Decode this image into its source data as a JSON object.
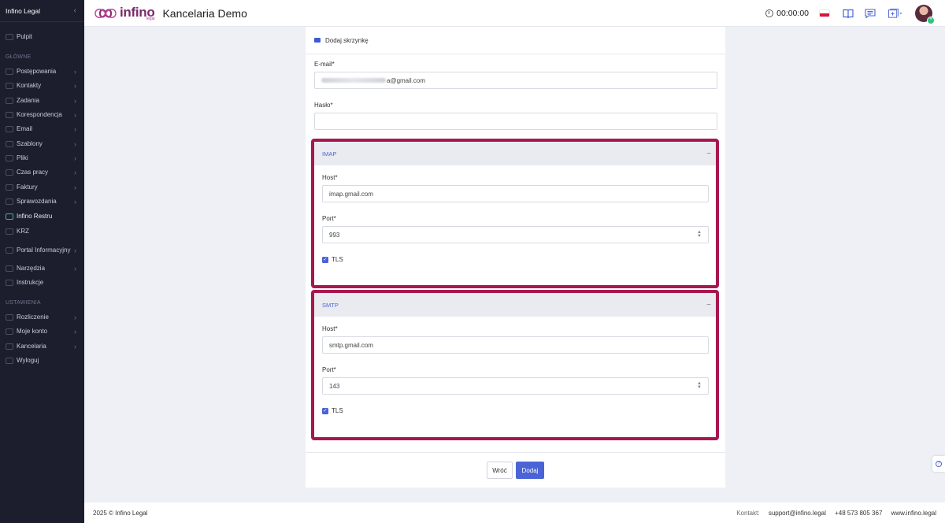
{
  "sidebar": {
    "title": "Infino Legal",
    "collapse_icon": "chevron-left-icon",
    "section_main": "GŁÓWNE",
    "section_settings": "USTAWIENIA",
    "top_item": {
      "label": "Pulpit",
      "icon": "dashboard-icon"
    },
    "main_items": [
      {
        "label": "Postępowania",
        "icon": "gavel-icon",
        "chevron": "›"
      },
      {
        "label": "Kontakty",
        "icon": "contacts-icon",
        "chevron": "›"
      },
      {
        "label": "Zadania",
        "icon": "tasks-icon",
        "chevron": "›"
      },
      {
        "label": "Korespondencja",
        "icon": "mail-icon",
        "chevron": "›"
      },
      {
        "label": "Email",
        "icon": "email-icon",
        "chevron": "›"
      },
      {
        "label": "Szablony",
        "icon": "templates-icon",
        "chevron": "›"
      },
      {
        "label": "Pliki",
        "icon": "files-icon",
        "chevron": "›"
      },
      {
        "label": "Czas pracy",
        "icon": "clock-icon",
        "chevron": "›"
      },
      {
        "label": "Faktury",
        "icon": "invoice-icon",
        "chevron": "›"
      },
      {
        "label": "Sprawozdania",
        "icon": "reports-icon",
        "chevron": "›"
      },
      {
        "label": "Infino Restru",
        "icon": "infinity-icon",
        "chevron": ""
      },
      {
        "label": "KRZ",
        "icon": "registry-icon",
        "chevron": ""
      },
      {
        "label": "Portal Informacyjny",
        "icon": "portal-icon",
        "chevron": "›"
      },
      {
        "label": "Narzędzia",
        "icon": "tools-icon",
        "chevron": "›"
      },
      {
        "label": "Instrukcje",
        "icon": "book-icon",
        "chevron": ""
      }
    ],
    "settings_items": [
      {
        "label": "Rozliczenie",
        "icon": "billing-icon",
        "chevron": "›"
      },
      {
        "label": "Moje konto",
        "icon": "user-icon",
        "chevron": "›"
      },
      {
        "label": "Kancelaria",
        "icon": "office-icon",
        "chevron": "›"
      },
      {
        "label": "Wyloguj",
        "icon": "logout-icon",
        "chevron": ""
      }
    ]
  },
  "topbar": {
    "logo_text": "infino",
    "logo_sub": "legal",
    "app_title": "Kancelaria Demo",
    "timer": "00:00:00",
    "icons": [
      "clock-icon",
      "poland-flag-icon",
      "book-icon",
      "chat-icon",
      "add-window-icon",
      "avatar"
    ]
  },
  "form": {
    "header": "Dodaj skrzynkę",
    "email_label": "E-mail*",
    "email_value_visible": "a@gmail.com",
    "password_label": "Hasło*",
    "password_value": "",
    "imap": {
      "title": "IMAP",
      "collapse": "−",
      "host_label": "Host*",
      "host_value": "imap.gmail.com",
      "port_label": "Port*",
      "port_value": "993",
      "tls_label": "TLS",
      "tls_checked": true
    },
    "smtp": {
      "title": "SMTP",
      "collapse": "−",
      "host_label": "Host*",
      "host_value": "smtp.gmail.com",
      "port_label": "Port*",
      "port_value": "143",
      "tls_label": "TLS",
      "tls_checked": true
    },
    "back_label": "Wróć",
    "submit_label": "Dodaj"
  },
  "footer": {
    "copyright": "2025 © Infino Legal",
    "contact_label": "Kontakt:",
    "email": "support@infino.legal",
    "phone": "+48 573 805 367",
    "website": "www.infino.legal"
  },
  "colors": {
    "sidebar_bg": "#1c1e2e",
    "accent": "#4a63d6",
    "highlight_border": "#a7174f",
    "brand": "#7b2a6a"
  }
}
